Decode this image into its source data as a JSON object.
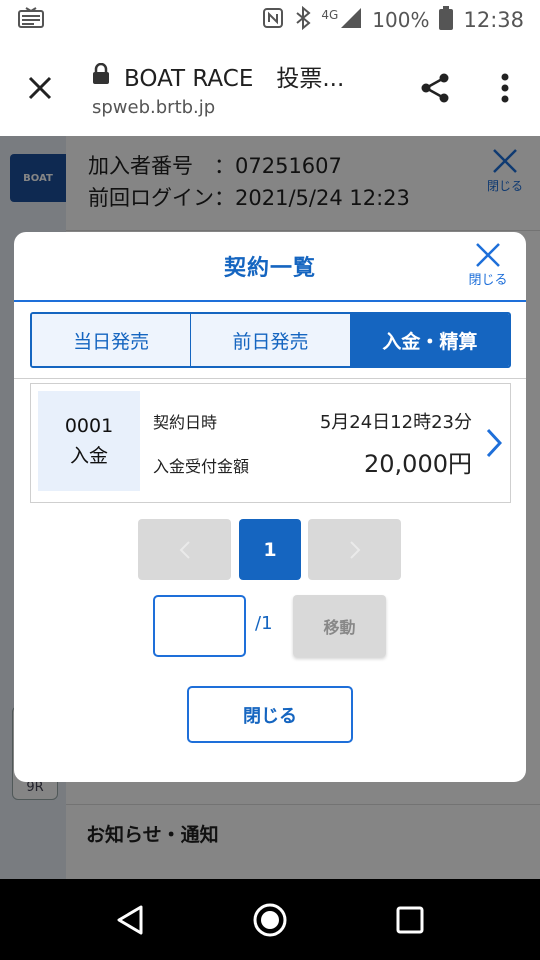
{
  "status_bar": {
    "network_label": "4G",
    "battery_percent": "100%",
    "time": "12:38",
    "icons": [
      "news-notification-icon",
      "nfc-icon",
      "bluetooth-icon",
      "signal-icon",
      "battery-icon"
    ]
  },
  "browser": {
    "page_title": "BOAT RACE　投票...",
    "url": "spweb.brtb.jp",
    "icons": [
      "close-icon",
      "lock-icon",
      "share-icon",
      "more-vert-icon"
    ]
  },
  "background_page": {
    "subscriber_line": "加入者番号　：07251607",
    "last_login_line": "前回ログイン：2021/5/24 12:23",
    "close_label": "閉じる",
    "notices_label": "お知らせ・通知",
    "race_label": "9R"
  },
  "modal": {
    "title": "契約一覧",
    "close_label": "閉じる",
    "tabs": [
      {
        "label": "当日発売",
        "active": false
      },
      {
        "label": "前日発売",
        "active": false
      },
      {
        "label": "入金・精算",
        "active": true
      }
    ],
    "contract": {
      "number": "0001",
      "type": "入金",
      "date_label": "契約日時",
      "date_value": "5月24日12時23分",
      "amount_label": "入金受付金額",
      "amount_value": "20,000円"
    },
    "pager": {
      "prev": "‹",
      "current": "1",
      "next": "›",
      "input_value": "",
      "total": "/1",
      "move_label": "移動"
    },
    "close_button": "閉じる"
  },
  "colors": {
    "accent": "#1565c0",
    "accent_light": "#1e6fd9",
    "disabled": "#d9d9d9",
    "badge_bg": "#e8f0fb"
  }
}
